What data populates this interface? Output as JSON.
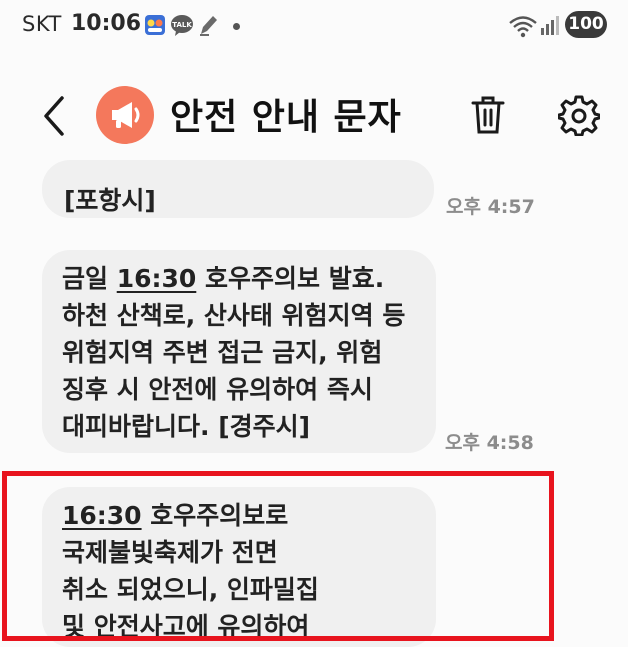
{
  "status_bar": {
    "carrier": "SKT",
    "time": "10:06",
    "notification_icons": [
      "game-app-icon",
      "kakaotalk-icon",
      "pen-icon"
    ],
    "kakao_label": "TALK",
    "battery": "100"
  },
  "header": {
    "title": "안전 안내 문자",
    "avatar_icon": "megaphone-icon",
    "avatar_color": "#f4785c"
  },
  "messages": [
    {
      "lines": [
        {
          "pre": "[포항시]",
          "time": "",
          "post": ""
        }
      ],
      "timestamp": "오후 4:57"
    },
    {
      "lines": [
        {
          "pre": "금일 ",
          "time": "16:30",
          "post": " 호우주의보 발효."
        },
        {
          "pre": "하천 산책로, 산사태 위험지역 등",
          "time": "",
          "post": ""
        },
        {
          "pre": "위험지역 주변 접근 금지, 위험",
          "time": "",
          "post": ""
        },
        {
          "pre": "징후 시 안전에 유의하여 즉시",
          "time": "",
          "post": ""
        },
        {
          "pre": "대피바랍니다. [경주시]",
          "time": "",
          "post": ""
        }
      ],
      "timestamp": "오후 4:58"
    },
    {
      "lines": [
        {
          "pre": "",
          "time": "16:30",
          "post": " 호우주의보로"
        },
        {
          "pre": "국제불빛축제가 전면",
          "time": "",
          "post": ""
        },
        {
          "pre": "취소 되었으니, 인파밀집",
          "time": "",
          "post": ""
        },
        {
          "pre": "및 안전사고에 유의하여",
          "time": "",
          "post": ""
        }
      ],
      "timestamp": ""
    }
  ],
  "colors": {
    "background": "#fbfbfb",
    "bubble": "#f0f0f0",
    "highlight": "#e8141e",
    "timestamp": "#8c8c8c"
  }
}
